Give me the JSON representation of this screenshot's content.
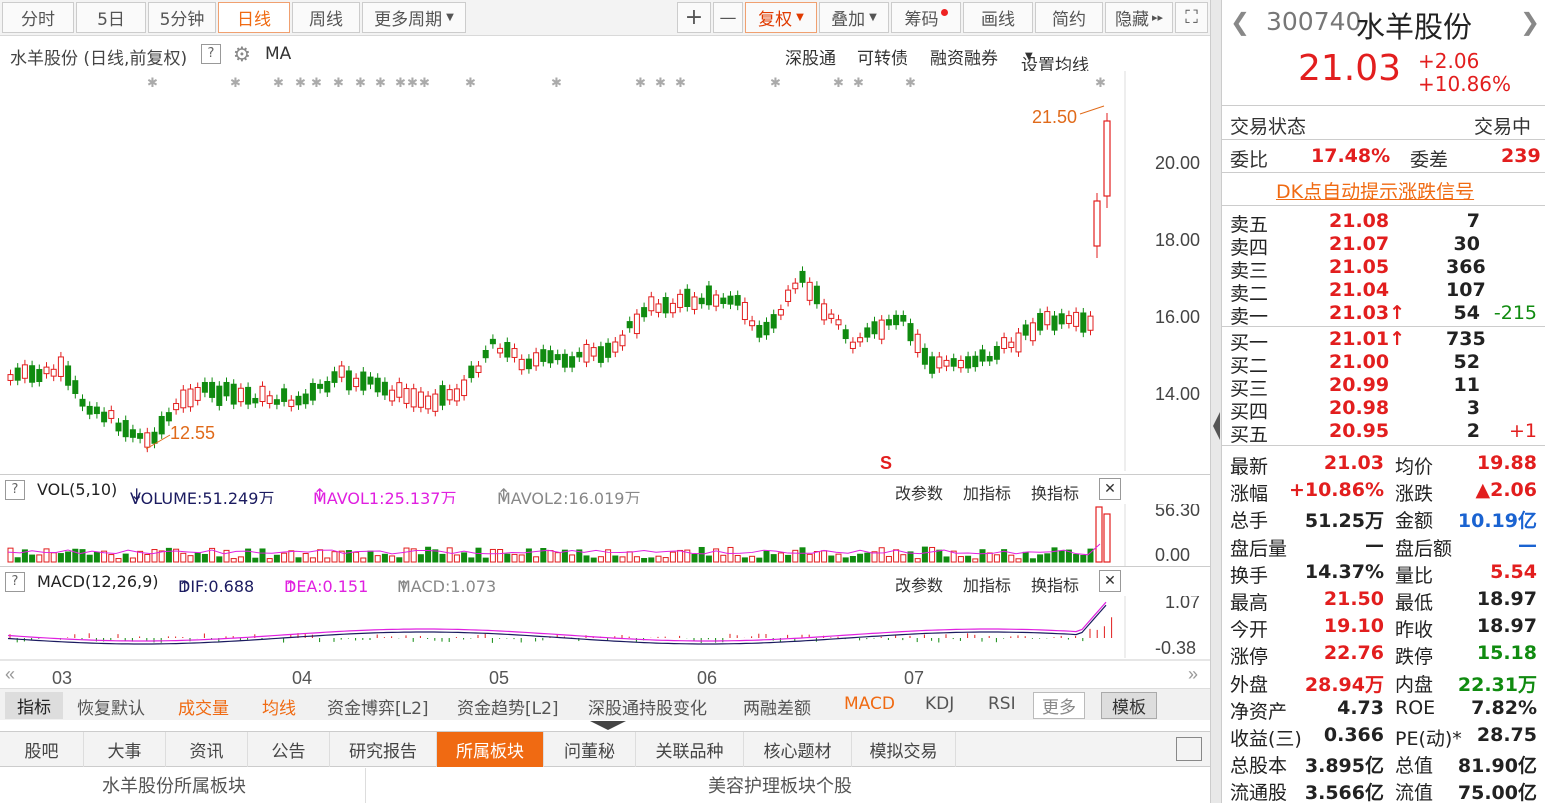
{
  "toolbar": {
    "fen": "分时",
    "d5": "5日",
    "m5": "5分钟",
    "day": "日线",
    "week": "周线",
    "more": "更多周期",
    "plus": "+",
    "minus": "—",
    "fuquan": "复权",
    "overlay": "叠加",
    "chips": "筹码",
    "draw": "画线",
    "simple": "简约",
    "hide": "隐藏",
    "hide_arrow": "▸▸",
    "expand": "⛶"
  },
  "chart_header": {
    "title": "水羊股份 (日线,前复权)",
    "help": "?",
    "ma": "MA",
    "links": [
      "深股通",
      "可转债",
      "融资融券",
      "设置均线"
    ]
  },
  "price_axis": [
    "20.00",
    "18.00",
    "16.00",
    "14.00"
  ],
  "annotations": {
    "high": "21.50",
    "low": "12.55",
    "s_marker": "S"
  },
  "vol_header": {
    "help": "?",
    "name": "VOL(5,10)",
    "volume": "VOLUME:51.249万",
    "volume_arrow": "↓",
    "mavol1": "MAVOL1:25.137万",
    "mavol1_arrow": "↑",
    "mavol2": "MAVOL2:16.019万",
    "mavol2_arrow": "↑",
    "change": "改参数",
    "add": "加指标",
    "swap": "换指标",
    "close": "✕"
  },
  "vol_axis": [
    "56.30",
    "0.00"
  ],
  "macd_header": {
    "help": "?",
    "name": "MACD(12,26,9)",
    "dif": "DIF:0.688",
    "dif_arrow": "↑",
    "dea": "DEA:0.151",
    "dea_arrow": "↑",
    "macd": "MACD:1.073",
    "macd_arrow": "↑",
    "change": "改参数",
    "add": "加指标",
    "swap": "换指标",
    "close": "✕"
  },
  "macd_axis": [
    "1.07",
    "-0.38"
  ],
  "months": [
    "03",
    "04",
    "05",
    "06",
    "07"
  ],
  "bottom_bar": [
    "指标",
    "恢复默认",
    "成交量",
    "均线",
    "资金博弈[L2]",
    "资金趋势[L2]",
    "深股通持股变化",
    "两融差额",
    "MACD",
    "KDJ",
    "RSI",
    "更多",
    "模板"
  ],
  "tabs": [
    "股吧",
    "大事",
    "资讯",
    "公告",
    "研究报告",
    "所属板块",
    "问董秘",
    "关联品种",
    "核心题材",
    "模拟交易"
  ],
  "sub_titles": [
    "水羊股份所属板块",
    "美容护理板块个股"
  ],
  "stock": {
    "code": "300740",
    "name": "水羊股份",
    "price": "21.03",
    "change": "+2.06",
    "pct": "+10.86%"
  },
  "status": {
    "label": "交易状态",
    "value": "交易中"
  },
  "ratio": {
    "label1": "委比",
    "value1": "17.48%",
    "label2": "委差",
    "value2": "239"
  },
  "dk": "DK点自动提示涨跌信号",
  "asks": [
    {
      "label": "卖五",
      "price": "21.08",
      "vol": "7",
      "chg": ""
    },
    {
      "label": "卖四",
      "price": "21.07",
      "vol": "30",
      "chg": ""
    },
    {
      "label": "卖三",
      "price": "21.05",
      "vol": "366",
      "chg": ""
    },
    {
      "label": "卖二",
      "price": "21.04",
      "vol": "107",
      "chg": ""
    },
    {
      "label": "卖一",
      "price": "21.03↑",
      "vol": "54",
      "chg": "-215"
    }
  ],
  "bids": [
    {
      "label": "买一",
      "price": "21.01↑",
      "vol": "735",
      "chg": ""
    },
    {
      "label": "买二",
      "price": "21.00",
      "vol": "52",
      "chg": ""
    },
    {
      "label": "买三",
      "price": "20.99",
      "vol": "11",
      "chg": ""
    },
    {
      "label": "买四",
      "price": "20.98",
      "vol": "3",
      "chg": ""
    },
    {
      "label": "买五",
      "price": "20.95",
      "vol": "2",
      "chg": "+1"
    }
  ],
  "stats": [
    {
      "l1": "最新",
      "v1": "21.03",
      "l2": "均价",
      "v2": "19.88",
      "c1": "red",
      "c2": "red"
    },
    {
      "l1": "涨幅",
      "v1": "+10.86%",
      "l2": "涨跌",
      "v2": "▲2.06",
      "c1": "red",
      "c2": "red"
    },
    {
      "l1": "总手",
      "v1": "51.25万",
      "l2": "金额",
      "v2": "10.19亿",
      "c1": "blk",
      "c2": "blu"
    },
    {
      "l1": "盘后量",
      "v1": "—",
      "l2": "盘后额",
      "v2": "—",
      "c1": "blk",
      "c2": "blu"
    },
    {
      "l1": "换手",
      "v1": "14.37%",
      "l2": "量比",
      "v2": "5.54",
      "c1": "blk",
      "c2": "red"
    },
    {
      "l1": "最高",
      "v1": "21.50",
      "l2": "最低",
      "v2": "18.97",
      "c1": "red",
      "c2": "blk"
    },
    {
      "l1": "今开",
      "v1": "19.10",
      "l2": "昨收",
      "v2": "18.97",
      "c1": "red",
      "c2": "blk"
    },
    {
      "l1": "涨停",
      "v1": "22.76",
      "l2": "跌停",
      "v2": "15.18",
      "c1": "red",
      "c2": "grn"
    },
    {
      "l1": "外盘",
      "v1": "28.94万",
      "l2": "内盘",
      "v2": "22.31万",
      "c1": "red",
      "c2": "grn"
    },
    {
      "l1": "净资产",
      "v1": "4.73",
      "l2": "ROE",
      "v2": "7.82%",
      "c1": "blk",
      "c2": "blk"
    },
    {
      "l1": "收益(三)",
      "v1": "0.366",
      "l2": "PE(动)*",
      "v2": "28.75",
      "c1": "blk",
      "c2": "blk"
    },
    {
      "l1": "总股本",
      "v1": "3.895亿",
      "l2": "总值",
      "v2": "81.90亿",
      "c1": "blk",
      "c2": "blk"
    },
    {
      "l1": "流通股",
      "v1": "3.566亿",
      "l2": "流值",
      "v2": "75.00亿",
      "c1": "blk",
      "c2": "blk"
    }
  ],
  "colors": {
    "up": "#e21e1e",
    "down": "#108b10",
    "accent": "#f06a12",
    "dif": "#1b1b60",
    "dea": "#e020e0"
  }
}
